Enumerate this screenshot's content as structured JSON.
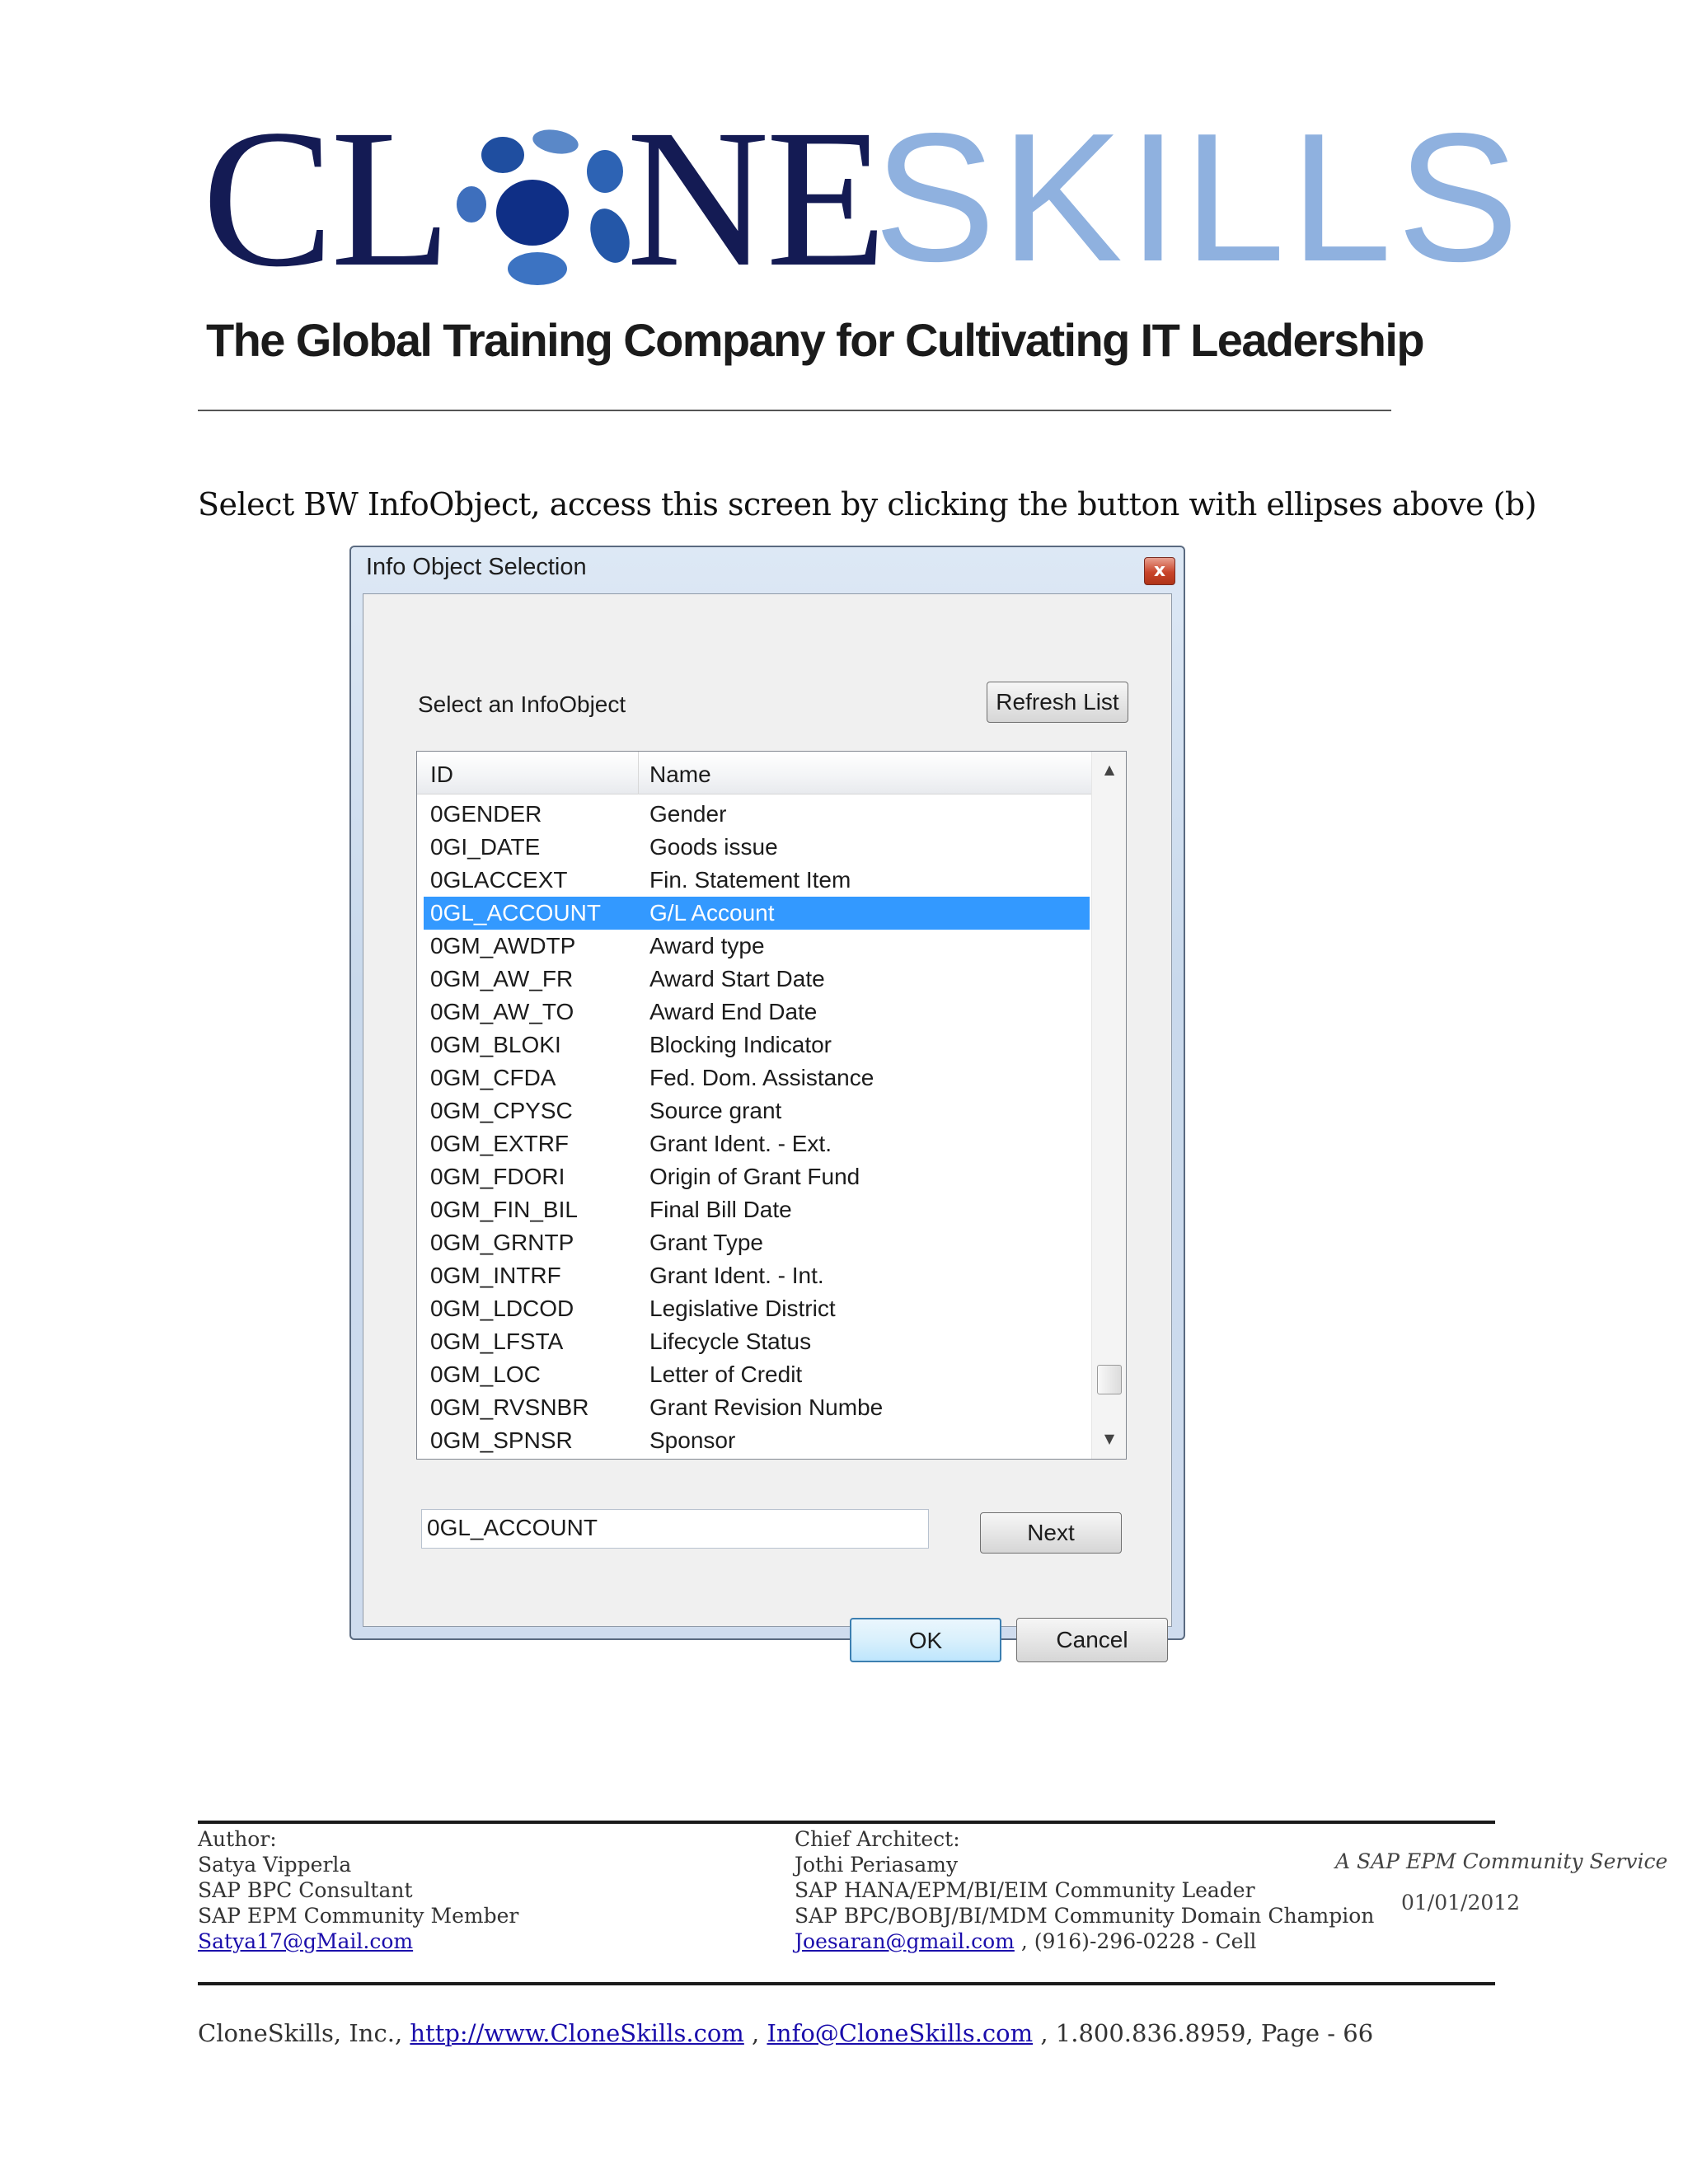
{
  "header": {
    "logo_text": "CLONESKILLS",
    "tagline": "The Global Training Company for Cultivating IT Leadership"
  },
  "caption": "Select BW InfoObject, access this screen by clicking the button with ellipses above (b)",
  "dialog": {
    "title": "Info Object Selection",
    "close_label": "x",
    "select_label": "Select an InfoObject",
    "refresh_label": "Refresh List",
    "columns": {
      "id": "ID",
      "name": "Name"
    },
    "rows": [
      {
        "id": "0GENDER",
        "name": "Gender"
      },
      {
        "id": "0GI_DATE",
        "name": "Goods issue"
      },
      {
        "id": "0GLACCEXT",
        "name": "Fin. Statement Item"
      },
      {
        "id": "0GL_ACCOUNT",
        "name": "G/L Account",
        "selected": true
      },
      {
        "id": "0GM_AWDTP",
        "name": "Award type"
      },
      {
        "id": "0GM_AW_FR",
        "name": "Award Start Date"
      },
      {
        "id": "0GM_AW_TO",
        "name": "Award End Date"
      },
      {
        "id": "0GM_BLOKI",
        "name": "Blocking Indicator"
      },
      {
        "id": "0GM_CFDA",
        "name": "Fed. Dom. Assistance"
      },
      {
        "id": "0GM_CPYSC",
        "name": "Source grant"
      },
      {
        "id": "0GM_EXTRF",
        "name": "Grant Ident. - Ext."
      },
      {
        "id": "0GM_FDORI",
        "name": "Origin of Grant Fund"
      },
      {
        "id": "0GM_FIN_BIL",
        "name": "Final Bill Date"
      },
      {
        "id": "0GM_GRNTP",
        "name": "Grant Type"
      },
      {
        "id": "0GM_INTRF",
        "name": "Grant Ident. - Int."
      },
      {
        "id": "0GM_LDCOD",
        "name": "Legislative District"
      },
      {
        "id": "0GM_LFSTA",
        "name": "Lifecycle Status"
      },
      {
        "id": "0GM_LOC",
        "name": "Letter of Credit"
      },
      {
        "id": "0GM_RVSNBR",
        "name": "Grant Revision Numbe"
      },
      {
        "id": "0GM_SPNSR",
        "name": "Sponsor"
      }
    ],
    "scroll_up": "▲",
    "scroll_down": "▼",
    "input_value": "0GL_ACCOUNT",
    "next_label": "Next",
    "ok_label": "OK",
    "cancel_label": "Cancel",
    "selection_color": "#3399ff"
  },
  "footer": {
    "author": {
      "heading": "Author:",
      "name": "Satya Vipperla",
      "role1": "SAP BPC Consultant",
      "role2": "SAP EPM Community Member",
      "email": "Satya17@gMail.com"
    },
    "architect": {
      "heading": "Chief Architect:",
      "name": "Jothi Periasamy",
      "role1": "SAP HANA/EPM/BI/EIM Community Leader",
      "role2": "SAP BPC/BOBJ/BI/MDM Community Domain Champion",
      "email": "Joesaran@gmail.com",
      "phone": " , (916)-296-0228 - Cell"
    },
    "service": "A SAP EPM Community Service",
    "date": "01/01/2012",
    "company_prefix": "CloneSkills, Inc., ",
    "website": "http://www.CloneSkills.com",
    "sep": " , ",
    "info_email": "Info@CloneSkills.com",
    "suffix": " , 1.800.836.8959, Page - 66"
  }
}
